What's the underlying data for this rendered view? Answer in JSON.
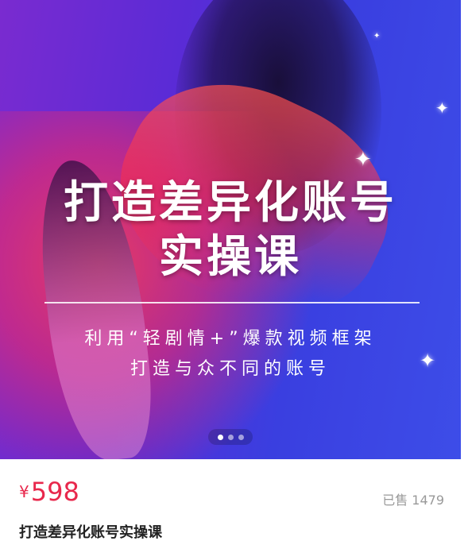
{
  "banner": {
    "title_line1": "打造差异化账号",
    "title_line2": "实操课",
    "subtitle_line1": "利用“轻剧情+”爆款视频框架",
    "subtitle_line2": "打造与众不同的账号",
    "carousel": {
      "total": 3,
      "active_index": 0
    }
  },
  "product": {
    "currency": "¥",
    "price": "598",
    "sold_label": "已售 1479",
    "title": "打造差异化账号实操课"
  },
  "colors": {
    "price": "#e8284c",
    "sold": "#999999",
    "title": "#222222"
  }
}
